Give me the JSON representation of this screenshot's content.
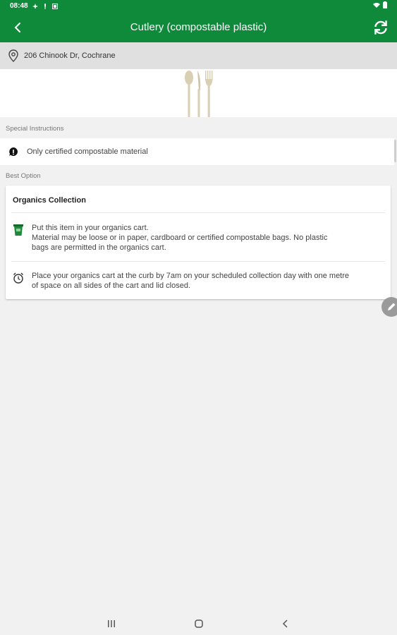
{
  "status_bar": {
    "time": "08:48"
  },
  "app_bar": {
    "title": "Cutlery (compostable plastic)",
    "back_icon": "arrow-back-icon",
    "refresh_icon": "refresh-icon"
  },
  "address": {
    "text": "206 Chinook Dr, Cochrane",
    "icon": "location-pin-icon"
  },
  "special_instructions": {
    "label": "Special Instructions",
    "items": [
      {
        "icon": "info-bubble-icon",
        "text": "Only certified compostable material"
      }
    ]
  },
  "best_option": {
    "label": "Best Option",
    "card": {
      "title": "Organics Collection",
      "rows": [
        {
          "icon": "organics-cart-icon",
          "lines": [
            "Put this item in your organics cart.",
            "Material may be loose or in paper, cardboard or certified compostable bags.  No plastic",
            "bags are permitted in the organics cart."
          ]
        },
        {
          "icon": "alarm-clock-icon",
          "lines": [
            "Place your organics cart at the curb by 7am on your scheduled collection day with one metre",
            "of space on all sides of the cart and lid closed."
          ]
        }
      ]
    }
  },
  "colors": {
    "primary": "#0f8a3b",
    "address_bg": "#e0e0e0",
    "page_bg": "#f1f1f1"
  }
}
